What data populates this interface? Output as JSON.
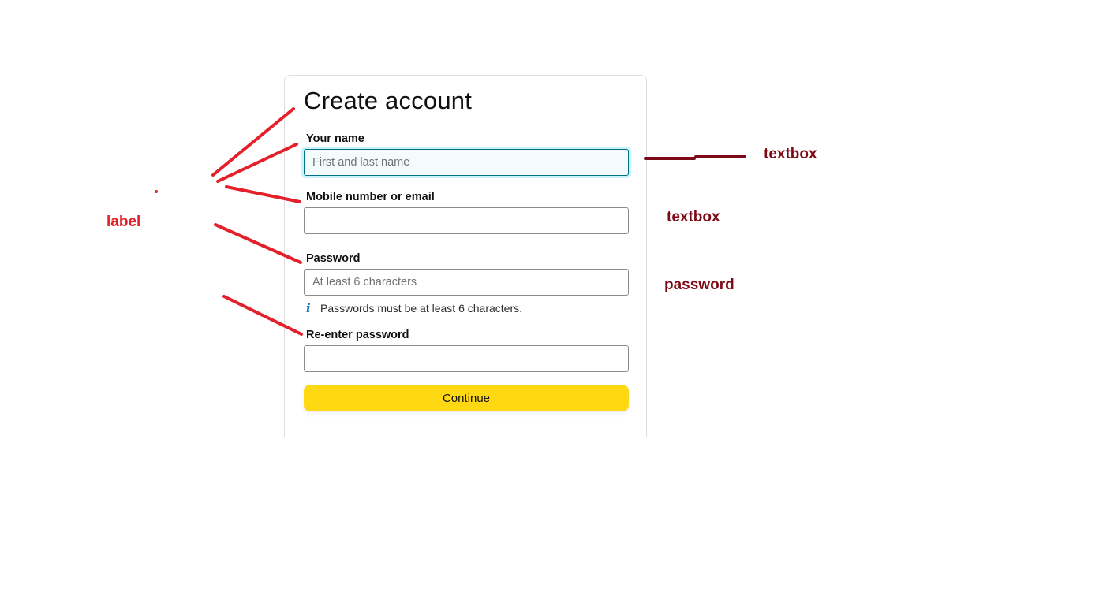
{
  "form": {
    "title": "Create account",
    "name_label": "Your name",
    "name_placeholder": "First and last name",
    "contact_label": "Mobile number or email",
    "contact_value": "",
    "password_label": "Password",
    "password_placeholder": "At least 6 characters",
    "password_hint": "Passwords must be at least 6 characters.",
    "reenter_label": "Re-enter password",
    "continue_label": "Continue",
    "hint_icon": "info-icon"
  },
  "annotations": {
    "label": "label",
    "textbox_1": "textbox",
    "textbox_2": "textbox",
    "password": "password",
    "colors": {
      "label": "#e4202a",
      "type": "#7f0a17"
    }
  },
  "colors": {
    "button": "#ffd814",
    "focus_border": "#007185",
    "info_icon": "#1f76b5"
  }
}
